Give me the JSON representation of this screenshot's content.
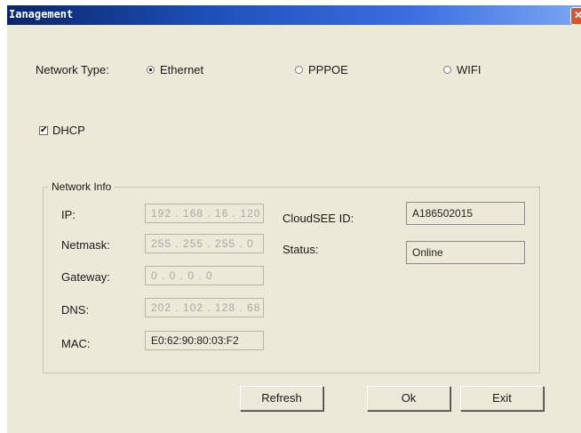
{
  "window": {
    "title": "Ianagement",
    "close_glyph": "✕"
  },
  "network_type": {
    "label": "Network Type:",
    "options": [
      {
        "label": "Ethernet",
        "selected": true
      },
      {
        "label": "PPPOE",
        "selected": false
      },
      {
        "label": "WIFI",
        "selected": false
      }
    ]
  },
  "dhcp": {
    "label": "DHCP",
    "checked": true,
    "check_glyph": "✔"
  },
  "network_info": {
    "title": "Network Info",
    "ip_label": "IP:",
    "ip_value": "192 . 168 . 16 . 120",
    "netmask_label": "Netmask:",
    "netmask_value": "255 . 255 . 255 .  0",
    "gateway_label": "Gateway:",
    "gateway_value": " 0  .  0  .  0  .  0",
    "dns_label": "DNS:",
    "dns_value": "202 . 102 . 128 . 68",
    "mac_label": "MAC:",
    "mac_value": "E0:62:90:80:03:F2",
    "cloudsee_label": "CloudSEE ID:",
    "cloudsee_value": "A186502015",
    "status_label": "Status:",
    "status_value": "Online"
  },
  "buttons": {
    "refresh": "Refresh",
    "ok": "Ok",
    "exit": "Exit"
  },
  "colors": {
    "dialog_bg": "#ece9d8",
    "title_bar": "#1c50b8",
    "close": "#e0502a"
  }
}
